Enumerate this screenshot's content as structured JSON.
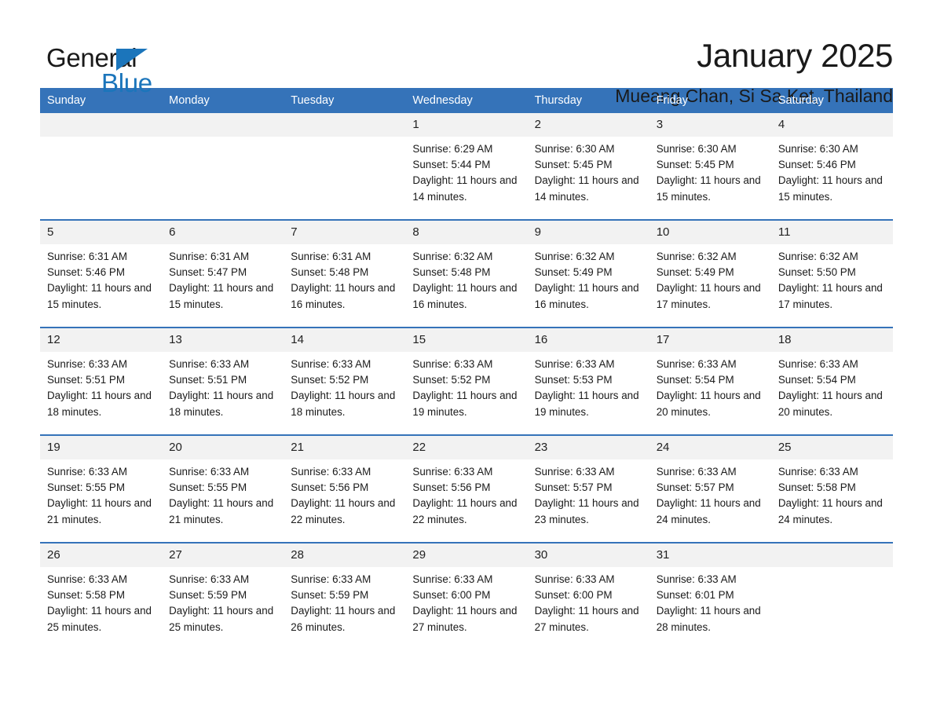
{
  "brand": {
    "name_part1": "General",
    "name_part2": "Blue",
    "accent_color": "#1b75bb"
  },
  "header": {
    "month_title": "January 2025",
    "location": "Mueang Chan, Si Sa Ket, Thailand"
  },
  "calendar": {
    "header_bg": "#3573b9",
    "daynum_bg": "#f2f2f2",
    "weekday_names": [
      "Sunday",
      "Monday",
      "Tuesday",
      "Wednesday",
      "Thursday",
      "Friday",
      "Saturday"
    ],
    "weeks": [
      [
        {
          "day": "",
          "blank": true
        },
        {
          "day": "",
          "blank": true
        },
        {
          "day": "",
          "blank": true
        },
        {
          "day": "1",
          "sunrise": "Sunrise: 6:29 AM",
          "sunset": "Sunset: 5:44 PM",
          "daylight": "Daylight: 11 hours and 14 minutes."
        },
        {
          "day": "2",
          "sunrise": "Sunrise: 6:30 AM",
          "sunset": "Sunset: 5:45 PM",
          "daylight": "Daylight: 11 hours and 14 minutes."
        },
        {
          "day": "3",
          "sunrise": "Sunrise: 6:30 AM",
          "sunset": "Sunset: 5:45 PM",
          "daylight": "Daylight: 11 hours and 15 minutes."
        },
        {
          "day": "4",
          "sunrise": "Sunrise: 6:30 AM",
          "sunset": "Sunset: 5:46 PM",
          "daylight": "Daylight: 11 hours and 15 minutes."
        }
      ],
      [
        {
          "day": "5",
          "sunrise": "Sunrise: 6:31 AM",
          "sunset": "Sunset: 5:46 PM",
          "daylight": "Daylight: 11 hours and 15 minutes."
        },
        {
          "day": "6",
          "sunrise": "Sunrise: 6:31 AM",
          "sunset": "Sunset: 5:47 PM",
          "daylight": "Daylight: 11 hours and 15 minutes."
        },
        {
          "day": "7",
          "sunrise": "Sunrise: 6:31 AM",
          "sunset": "Sunset: 5:48 PM",
          "daylight": "Daylight: 11 hours and 16 minutes."
        },
        {
          "day": "8",
          "sunrise": "Sunrise: 6:32 AM",
          "sunset": "Sunset: 5:48 PM",
          "daylight": "Daylight: 11 hours and 16 minutes."
        },
        {
          "day": "9",
          "sunrise": "Sunrise: 6:32 AM",
          "sunset": "Sunset: 5:49 PM",
          "daylight": "Daylight: 11 hours and 16 minutes."
        },
        {
          "day": "10",
          "sunrise": "Sunrise: 6:32 AM",
          "sunset": "Sunset: 5:49 PM",
          "daylight": "Daylight: 11 hours and 17 minutes."
        },
        {
          "day": "11",
          "sunrise": "Sunrise: 6:32 AM",
          "sunset": "Sunset: 5:50 PM",
          "daylight": "Daylight: 11 hours and 17 minutes."
        }
      ],
      [
        {
          "day": "12",
          "sunrise": "Sunrise: 6:33 AM",
          "sunset": "Sunset: 5:51 PM",
          "daylight": "Daylight: 11 hours and 18 minutes."
        },
        {
          "day": "13",
          "sunrise": "Sunrise: 6:33 AM",
          "sunset": "Sunset: 5:51 PM",
          "daylight": "Daylight: 11 hours and 18 minutes."
        },
        {
          "day": "14",
          "sunrise": "Sunrise: 6:33 AM",
          "sunset": "Sunset: 5:52 PM",
          "daylight": "Daylight: 11 hours and 18 minutes."
        },
        {
          "day": "15",
          "sunrise": "Sunrise: 6:33 AM",
          "sunset": "Sunset: 5:52 PM",
          "daylight": "Daylight: 11 hours and 19 minutes."
        },
        {
          "day": "16",
          "sunrise": "Sunrise: 6:33 AM",
          "sunset": "Sunset: 5:53 PM",
          "daylight": "Daylight: 11 hours and 19 minutes."
        },
        {
          "day": "17",
          "sunrise": "Sunrise: 6:33 AM",
          "sunset": "Sunset: 5:54 PM",
          "daylight": "Daylight: 11 hours and 20 minutes."
        },
        {
          "day": "18",
          "sunrise": "Sunrise: 6:33 AM",
          "sunset": "Sunset: 5:54 PM",
          "daylight": "Daylight: 11 hours and 20 minutes."
        }
      ],
      [
        {
          "day": "19",
          "sunrise": "Sunrise: 6:33 AM",
          "sunset": "Sunset: 5:55 PM",
          "daylight": "Daylight: 11 hours and 21 minutes."
        },
        {
          "day": "20",
          "sunrise": "Sunrise: 6:33 AM",
          "sunset": "Sunset: 5:55 PM",
          "daylight": "Daylight: 11 hours and 21 minutes."
        },
        {
          "day": "21",
          "sunrise": "Sunrise: 6:33 AM",
          "sunset": "Sunset: 5:56 PM",
          "daylight": "Daylight: 11 hours and 22 minutes."
        },
        {
          "day": "22",
          "sunrise": "Sunrise: 6:33 AM",
          "sunset": "Sunset: 5:56 PM",
          "daylight": "Daylight: 11 hours and 22 minutes."
        },
        {
          "day": "23",
          "sunrise": "Sunrise: 6:33 AM",
          "sunset": "Sunset: 5:57 PM",
          "daylight": "Daylight: 11 hours and 23 minutes."
        },
        {
          "day": "24",
          "sunrise": "Sunrise: 6:33 AM",
          "sunset": "Sunset: 5:57 PM",
          "daylight": "Daylight: 11 hours and 24 minutes."
        },
        {
          "day": "25",
          "sunrise": "Sunrise: 6:33 AM",
          "sunset": "Sunset: 5:58 PM",
          "daylight": "Daylight: 11 hours and 24 minutes."
        }
      ],
      [
        {
          "day": "26",
          "sunrise": "Sunrise: 6:33 AM",
          "sunset": "Sunset: 5:58 PM",
          "daylight": "Daylight: 11 hours and 25 minutes."
        },
        {
          "day": "27",
          "sunrise": "Sunrise: 6:33 AM",
          "sunset": "Sunset: 5:59 PM",
          "daylight": "Daylight: 11 hours and 25 minutes."
        },
        {
          "day": "28",
          "sunrise": "Sunrise: 6:33 AM",
          "sunset": "Sunset: 5:59 PM",
          "daylight": "Daylight: 11 hours and 26 minutes."
        },
        {
          "day": "29",
          "sunrise": "Sunrise: 6:33 AM",
          "sunset": "Sunset: 6:00 PM",
          "daylight": "Daylight: 11 hours and 27 minutes."
        },
        {
          "day": "30",
          "sunrise": "Sunrise: 6:33 AM",
          "sunset": "Sunset: 6:00 PM",
          "daylight": "Daylight: 11 hours and 27 minutes."
        },
        {
          "day": "31",
          "sunrise": "Sunrise: 6:33 AM",
          "sunset": "Sunset: 6:01 PM",
          "daylight": "Daylight: 11 hours and 28 minutes."
        },
        {
          "day": "",
          "blank": true
        }
      ]
    ]
  }
}
